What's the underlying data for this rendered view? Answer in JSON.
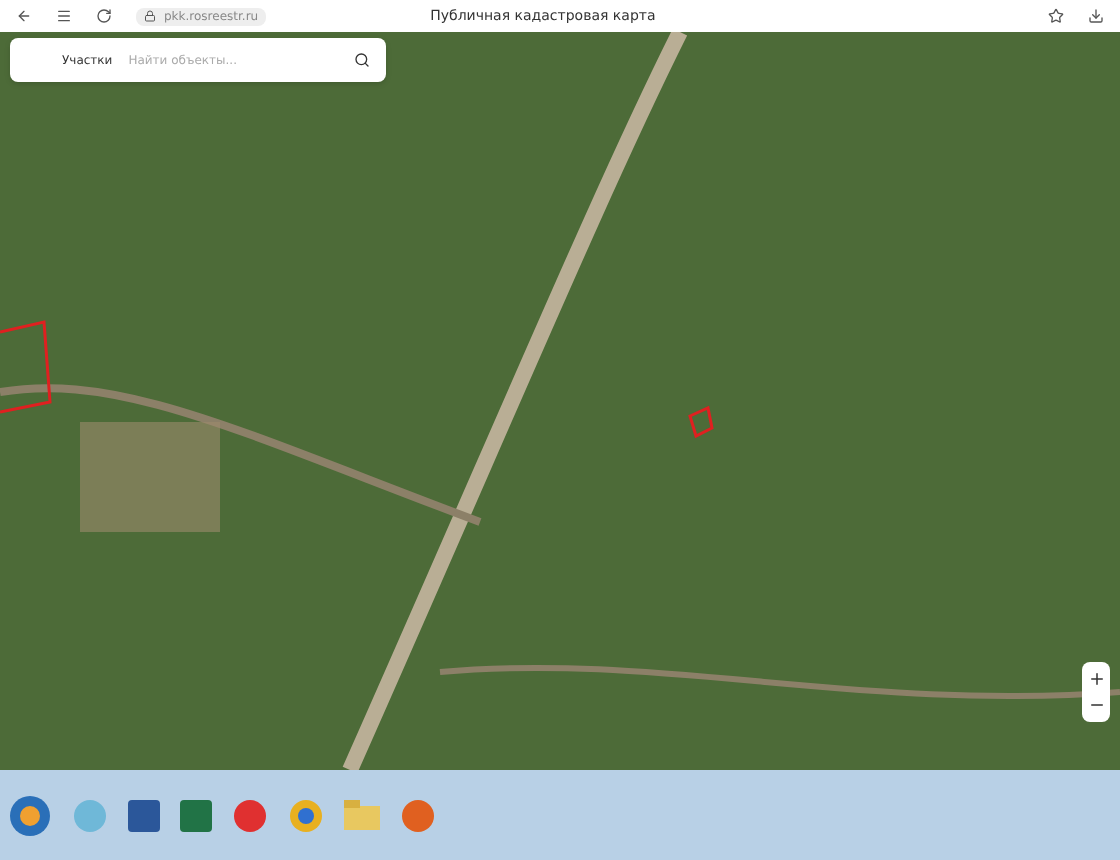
{
  "browser": {
    "url": "pkk.rosreestr.ru",
    "title": "Публичная кадастровая карта"
  },
  "search": {
    "tab": "Участки",
    "placeholder": "Найти объекты..."
  }
}
